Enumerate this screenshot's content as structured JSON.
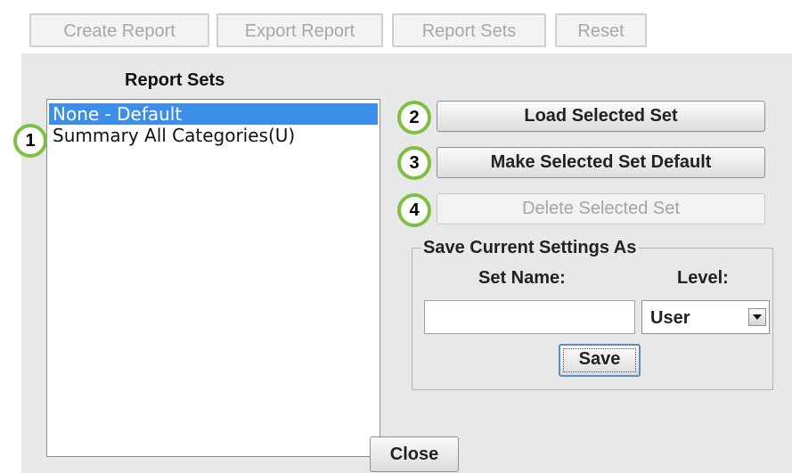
{
  "toolbar": {
    "create_report": "Create Report",
    "export_report": "Export Report",
    "report_sets": "Report Sets",
    "reset": "Reset"
  },
  "report_sets": {
    "title": "Report Sets",
    "items": [
      "None - Default",
      "Summary All Categories(U)"
    ],
    "selected": "None - Default"
  },
  "actions": {
    "load": "Load Selected Set",
    "make_default": "Make Selected Set Default",
    "delete": "Delete Selected Set"
  },
  "callouts": [
    "1",
    "2",
    "3",
    "4"
  ],
  "save_group": {
    "legend": "Save Current Settings As",
    "set_name_label": "Set Name:",
    "set_name_value": "",
    "level_label": "Level:",
    "level_value": "User",
    "save": "Save"
  },
  "footer": {
    "close": "Close"
  },
  "colors": {
    "selection": "#3c8ee8",
    "callout_ring": "#7fc043",
    "panel_bg": "#e8e8e8"
  },
  "icons": {
    "level_dropdown": "chevron-down-icon"
  }
}
